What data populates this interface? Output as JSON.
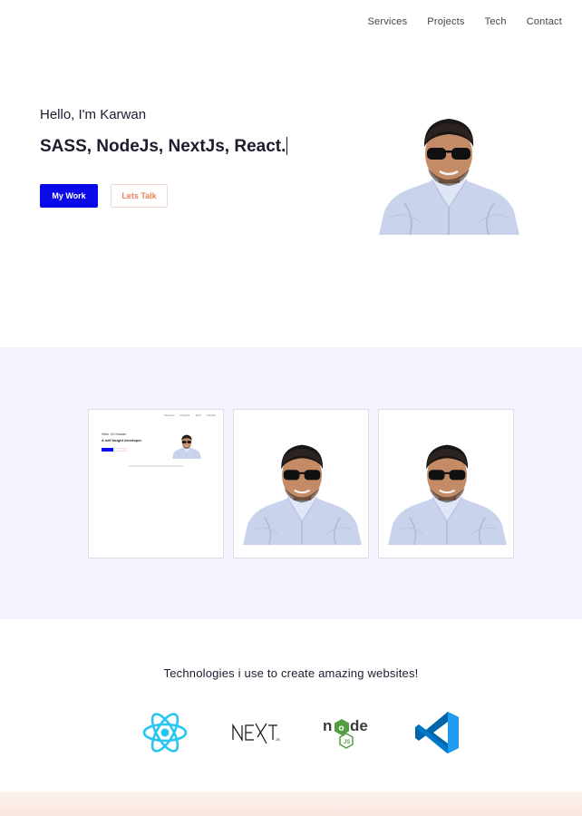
{
  "nav": {
    "items": [
      {
        "label": "Services"
      },
      {
        "label": "Projects"
      },
      {
        "label": "Tech"
      },
      {
        "label": "Contact"
      }
    ]
  },
  "hero": {
    "greeting": "Hello, I'm Karwan",
    "headline": "SASS, NodeJs, NextJs, React.",
    "primary_button": "My Work",
    "secondary_button": "Lets Talk"
  },
  "projects": {
    "card1_preview": {
      "nav": [
        "Services",
        "Projects",
        "Tech",
        "Contact"
      ],
      "greeting": "Hello, I'm Karwan",
      "title": "A self taught developer."
    }
  },
  "tech": {
    "heading": "Technologies i use to create amazing websites!",
    "logos": [
      {
        "name": "React",
        "icon": "react-icon",
        "color": "#61dafb"
      },
      {
        "name": "Next.js",
        "icon": "nextjs-icon",
        "color": "#111111"
      },
      {
        "name": "Node.js",
        "icon": "nodejs-icon",
        "color": "#539e43"
      },
      {
        "name": "VS Code",
        "icon": "vscode-icon",
        "color": "#007acc"
      }
    ]
  },
  "colors": {
    "primary": "#0a0ae8",
    "accent": "#e8825c",
    "projects_bg": "#f4f3fe"
  }
}
